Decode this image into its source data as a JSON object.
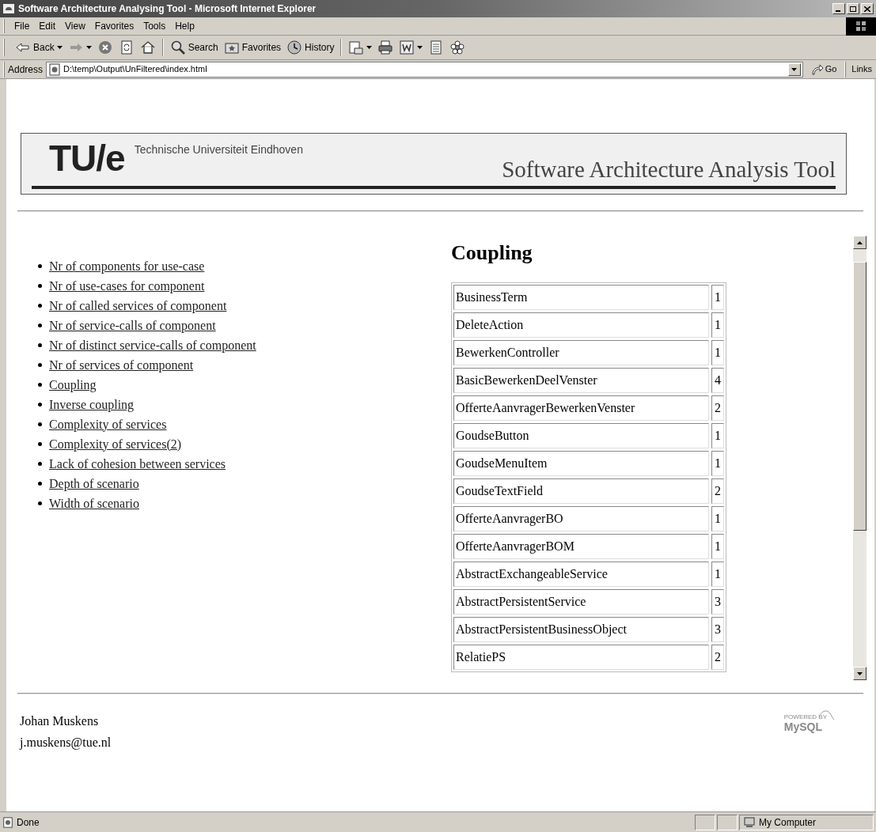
{
  "window": {
    "title": "Software Architecture Analysing Tool - Microsoft Internet Explorer"
  },
  "menu_bar": [
    "File",
    "Edit",
    "View",
    "Favorites",
    "Tools",
    "Help"
  ],
  "toolbar": [
    {
      "kind": "back",
      "label": "Back"
    },
    {
      "kind": "forward"
    },
    {
      "kind": "stop"
    },
    {
      "kind": "refresh"
    },
    {
      "kind": "home"
    },
    {
      "kind": "search",
      "label": "Search"
    },
    {
      "kind": "favorites",
      "label": "Favorites"
    },
    {
      "kind": "history",
      "label": "History"
    },
    {
      "kind": "mail"
    },
    {
      "kind": "print"
    },
    {
      "kind": "edit"
    },
    {
      "kind": "discuss"
    },
    {
      "kind": "messenger"
    }
  ],
  "address_bar": {
    "label": "Address",
    "value": "D:\\temp\\Output\\UnFiltered\\index.html",
    "go": "Go",
    "links": "Links"
  },
  "header": {
    "logo": "TU/e",
    "university": "Technische Universiteit Eindhoven",
    "tool_title": "Software Architecture Analysis Tool"
  },
  "nav_links": [
    "Nr of components for use-case",
    "Nr of use-cases for component",
    "Nr of called services of component",
    "Nr of service-calls of component",
    "Nr of distinct service-calls of component",
    "Nr of services of component",
    "Coupling",
    "Inverse coupling",
    "Complexity of services",
    "Complexity of services(2)",
    "Lack of cohesion between services",
    "Depth of scenario",
    "Width of scenario"
  ],
  "section": {
    "heading": "Coupling",
    "rows": [
      {
        "name": "BusinessTerm",
        "value": "1"
      },
      {
        "name": "DeleteAction",
        "value": "1"
      },
      {
        "name": "BewerkenController",
        "value": "1"
      },
      {
        "name": "BasicBewerkenDeelVenster",
        "value": "4"
      },
      {
        "name": "OfferteAanvragerBewerkenVenster",
        "value": "2"
      },
      {
        "name": "GoudseButton",
        "value": "1"
      },
      {
        "name": "GoudseMenuItem",
        "value": "1"
      },
      {
        "name": "GoudseTextField",
        "value": "2"
      },
      {
        "name": "OfferteAanvragerBO",
        "value": "1"
      },
      {
        "name": "OfferteAanvragerBOM",
        "value": "1"
      },
      {
        "name": "AbstractExchangeableService",
        "value": "1"
      },
      {
        "name": "AbstractPersistentService",
        "value": "3"
      },
      {
        "name": "AbstractPersistentBusinessObject",
        "value": "3"
      },
      {
        "name": "RelatiePS",
        "value": "2"
      }
    ]
  },
  "footer": {
    "name": "Johan Muskens",
    "email": "j.muskens@tue.nl",
    "badge_top": "POWERED BY",
    "badge_brand": "MySQL"
  },
  "status_bar": {
    "text": "Done",
    "zone": "My Computer"
  }
}
